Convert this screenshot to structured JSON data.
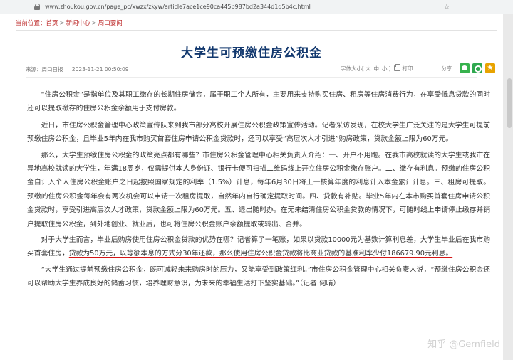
{
  "browser": {
    "url": "www.zhoukou.gov.cn/page_pc/xwzx/zkyw/article7ace1ce90ca445b987bd2a344d1d5b4c.html"
  },
  "breadcrumb": {
    "label": "当前位置：",
    "items": [
      "首页",
      "新闻中心",
      "周口要闻"
    ],
    "separator": ">"
  },
  "article": {
    "title": "大学生可预缴住房公积金",
    "source": "来源：周口日报",
    "time": "2023-11-21 00:50:09",
    "font_size_label": "字体大小[",
    "font_sizes": [
      "大",
      "中",
      "小"
    ],
    "font_size_end": "]",
    "print_label": "打印",
    "share_label": "分享:",
    "paragraphs": [
      "“住房公积金”是指单位及其职工缴存的长期住房储金，属于职工个人所有，主要用来支持购买住房、租房等住房消费行为，在享受低息贷款的同时还可以提取缴存的住房公积金余额用于支付房款。",
      "近日，市住房公积金管理中心政策宣传队来到我市部分高校开展住房公积金政策宣传活动。记者采访发现，在校大学生广泛关注的是大学生可提前预缴住房公积金，且毕业5年内在我市购买首套住房申请公积金贷款时，还可以享受“高层次人才引进”购房政策，贷款金额上限为60万元。",
      "那么，大学生预缴住房公积金的政策亮点都有哪些？市住房公积金管理中心相关负责人介绍：一、开户不用跑。在我市高校就读的大学生或我市在异地高校就读的大学生，年满18周岁，仅需提供本人身份证、银行卡便可扫描二维码线上开立住房公积金缴存账户。二、缴存有利息。预缴的住房公积金自计入个人住房公积金账户之日起按照国家规定的利率（1.5%）计息，每年6月30日将上一核算年度的利息计入本金累计计息。三、租房可提取。预缴的住房公积金每年会有两次机会可以申请一次租房提取，自然年内自行确定提取时间。四、贷款有补贴。毕业5年内在本市购买首套住房申请公积金贷款时，享受引进高层次人才政策，贷款金额上限为60万元。五、退出随时办。在无未结清住房公积金贷款的情况下，可随时线上申请停止缴存并销户提取住房公积金，到外地创业、就业后，也可将住房公积金账户余额提取或转出、合并。",
      "对于大学生而言，毕业后购房使用住房公积金贷款的优势在哪？记者算了一笔账，如果以贷款10000元为基数计算利息差，大学生毕业后在我市购买首套住房，",
      "“大学生通过提前预缴住房公积金，既可减轻未来购房时的压力，又能享受到政策红利。”市住房公积金管理中心相关负责人说，“预缴住房公积金还可以帮助大学生养成良好的储蓄习惯，培养理财意识，为未来的幸福生活打下坚实基础。”（记者 何晴）"
    ],
    "highlight": "贷款为50万元，以等额本息的方式分30年还款，那么使用住房公积金贷款将比商业贷款的基准利率少付186679.90元利息。"
  },
  "watermark": "知乎 @Gemfield",
  "colors": {
    "title": "#12386e",
    "breadcrumb": "#b22222",
    "underline": "#d41414"
  }
}
